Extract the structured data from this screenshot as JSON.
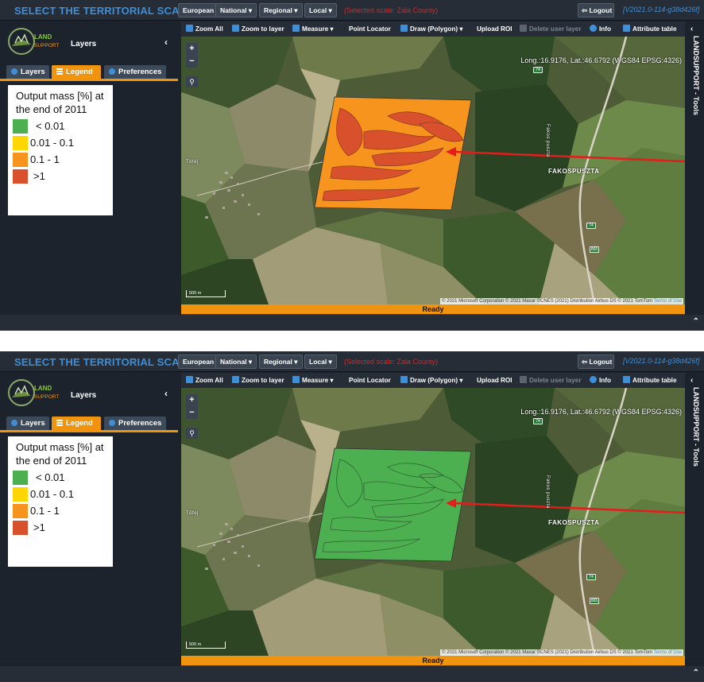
{
  "header": {
    "scale_title": "SELECT THE TERRITORIAL SCALE:",
    "scale_buttons": [
      "European",
      "National ▾",
      "Regional ▾",
      "Local ▾"
    ],
    "selected_scale": "(Selected scale: Zala County)",
    "logout": "Logout",
    "version": "[V2021.0-114-g38d426f]"
  },
  "sidebar": {
    "title": "Layers",
    "logo_text_top": "LAND",
    "logo_text_bottom": "SUPPORT",
    "tabs": [
      "Layers",
      "Legend",
      "Preferences"
    ],
    "active_tab": "Legend"
  },
  "legend": {
    "title": "Output mass [%] at the end of 2011",
    "items": [
      {
        "label": "< 0.01",
        "color": "#4caf50"
      },
      {
        "label": "0.01 - 0.1",
        "color": "#ffd600"
      },
      {
        "label": "0.1 - 1",
        "color": "#f7941d"
      },
      {
        "label": ">1",
        "color": "#d9512c"
      }
    ]
  },
  "toolbar": {
    "zoom_all": "Zoom All",
    "zoom_to_layer": "Zoom to layer",
    "measure": "Measure",
    "point_locator": "Point Locator",
    "draw_polygon": "Draw (Polygon)",
    "upload_roi": "Upload ROI",
    "delete_user_layer": "Delete user layer",
    "info": "Info",
    "attribute_table": "Attribute table"
  },
  "map": {
    "coords": "Long.:16.9176, Lat.:46.6792 (WGS84 EPSG:4326)",
    "scale_bar": "500 m",
    "attribution": "© 2021 Microsoft Corporation © 2021 Maxar ©CNES (2021) Distribution Airbus DS © 2021 TomTom",
    "terms": "Terms of Use",
    "place_fakospuszta": "FAKOSPUSZTA",
    "place_tofej": "Tófej",
    "road_74": "74",
    "road_865": "865",
    "road_fakos": "Fakos puszta"
  },
  "status": "Ready",
  "right_tools": "LANDSUPPORT - Tools",
  "colors": {
    "accent": "#f0940f",
    "brand_blue": "#3f8fd8",
    "alert_red": "#d12a2a"
  }
}
